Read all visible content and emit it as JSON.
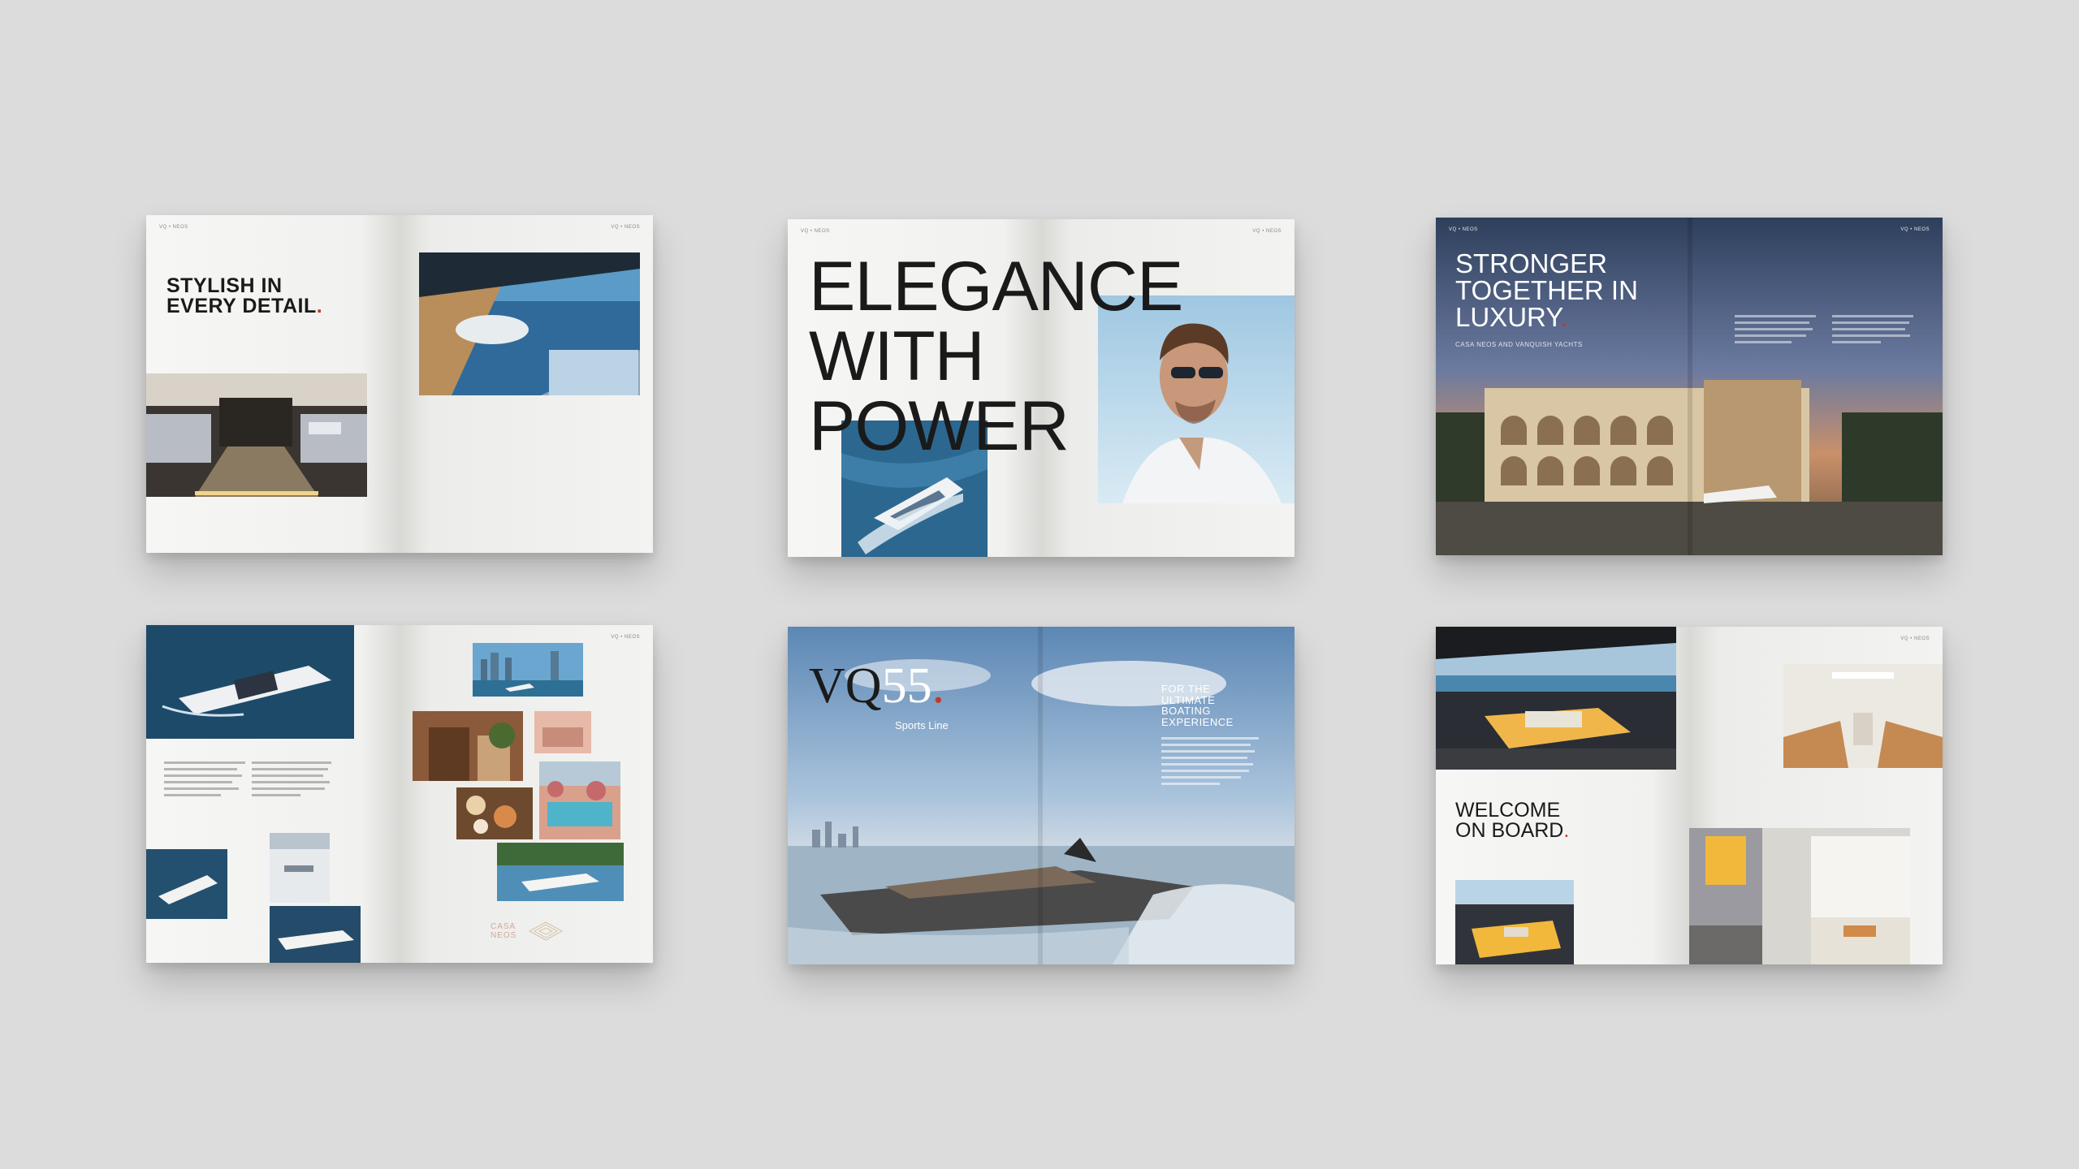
{
  "spreads": {
    "s1": {
      "headline_lines": [
        "STYLISH IN",
        "EVERY DETAIL."
      ],
      "folio_left": "VQ • NEOS",
      "folio_right": "VQ • NEOS"
    },
    "s2": {
      "headline_lines": [
        "ELEGANCE",
        "WITH",
        "POWER"
      ],
      "folio_left": "VQ • NEOS",
      "folio_right": "VQ • NEOS"
    },
    "s3": {
      "headline_lines": [
        "STRONGER",
        "TOGETHER IN",
        "LUXURY."
      ],
      "subhead": "CASA NEOS AND VANQUISH YACHTS",
      "folio_left": "VQ • NEOS",
      "folio_right": "VQ • NEOS"
    },
    "s4": {
      "logo_text_line1": "CASA",
      "logo_text_line2": "NEOS",
      "folio_right": "VQ • NEOS"
    },
    "s5": {
      "model_vq": "VQ",
      "model_num": "55",
      "model_dot": ".",
      "model_line": "Sports Line",
      "side_heading_lines": [
        "FOR THE",
        "ULTIMATE",
        "BOATING",
        "EXPERIENCE"
      ]
    },
    "s6": {
      "headline_lines": [
        "WELCOME",
        "ON BOARD."
      ],
      "folio_right": "VQ • NEOS"
    }
  },
  "colors": {
    "background": "#dcdcdc",
    "accent_red": "#c0392b",
    "ink": "#1a1a1a"
  }
}
